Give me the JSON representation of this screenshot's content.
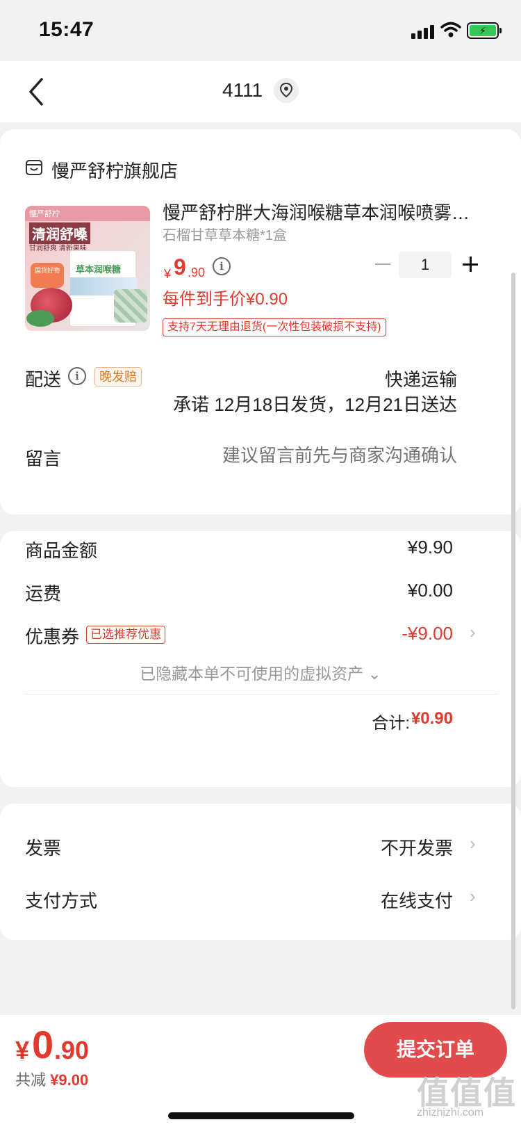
{
  "status_bar": {
    "time": "15:47"
  },
  "nav": {
    "title": "4111"
  },
  "store": {
    "name": "慢严舒柠旗舰店"
  },
  "product": {
    "image_text": {
      "brand": "慢严舒柠",
      "title": "清润舒嗓",
      "sub": "甘润舒爽 清新果味",
      "box_title": "草本润喉糖",
      "badge": "国货好物"
    },
    "title": "慢严舒柠胖大海润喉糖草本润喉喷雾…",
    "spec": "石榴甘草草本糖*1盒",
    "price_symbol": "¥",
    "price_int": "9",
    "price_dec": ".90",
    "quantity": "1",
    "final_price": "每件到手价¥0.90",
    "return_policy": "支持7天无理由退货(一次性包装破损不支持)"
  },
  "delivery": {
    "label": "配送",
    "late_tag": "晚发赔",
    "method": "快递运输",
    "promise": "承诺 12月18日发货，12月21日送达"
  },
  "remark": {
    "label": "留言",
    "placeholder": "建议留言前先与商家沟通确认"
  },
  "summary": {
    "goods_label": "商品金额",
    "goods_value": "¥9.90",
    "shipping_label": "运费",
    "shipping_value": "¥0.00",
    "coupon_label": "优惠券",
    "coupon_tag": "已选推荐优惠",
    "coupon_value": "-¥9.00",
    "hidden_assets": "已隐藏本单不可使用的虚拟资产 ⌄",
    "total_label": "合计:",
    "total_value": "¥0.90"
  },
  "invoice": {
    "label": "发票",
    "value": "不开发票"
  },
  "payment": {
    "label": "支付方式",
    "value": "在线支付"
  },
  "bottom_bar": {
    "price_symbol": "¥",
    "price_int": "0",
    "price_dec": ".90",
    "saved_label": "共减",
    "saved_value": "¥9.00",
    "submit_label": "提交订单"
  },
  "watermark": {
    "text": "值值值",
    "url": "zhizhizhi.com"
  },
  "colors": {
    "accent": "#e1392d",
    "button": "#e14b4b",
    "background": "#f2f2f2"
  }
}
